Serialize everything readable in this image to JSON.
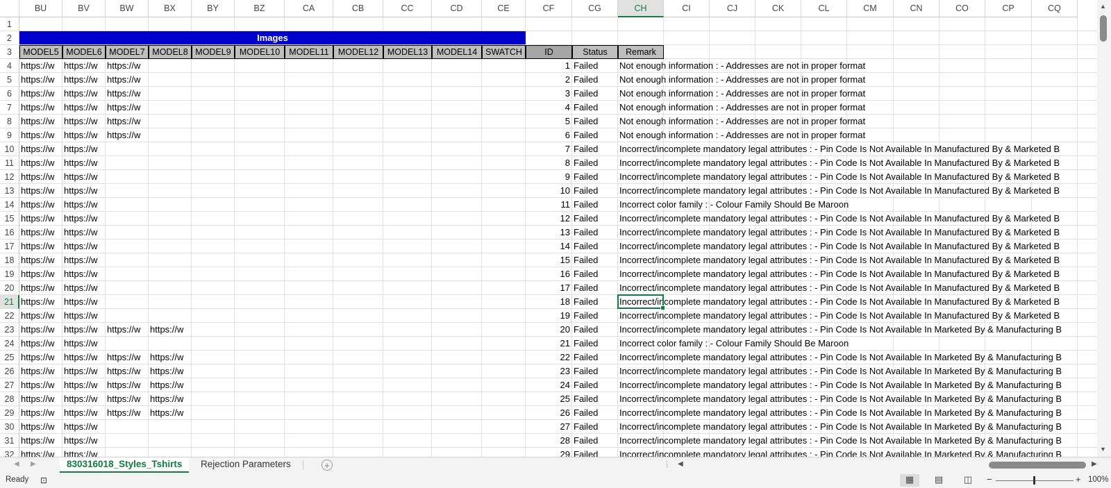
{
  "columns": [
    "BU",
    "BV",
    "BW",
    "BX",
    "BY",
    "BZ",
    "CA",
    "CB",
    "CC",
    "CD",
    "CE",
    "CF",
    "CG",
    "CH",
    "CI",
    "CJ",
    "CK",
    "CL",
    "CM",
    "CN",
    "CO",
    "CP",
    "CQ"
  ],
  "selected_column": "CH",
  "row_numbers": [
    "1",
    "2",
    "3",
    "4",
    "5",
    "6",
    "7",
    "8",
    "9",
    "10",
    "11",
    "12",
    "13",
    "14",
    "15",
    "16",
    "17",
    "18",
    "19",
    "20",
    "21",
    "22",
    "23",
    "24",
    "25",
    "26",
    "27",
    "28",
    "29",
    "30",
    "31",
    "32"
  ],
  "selected_row": "21",
  "banner_title": "Images",
  "header_row": [
    "MODEL5",
    "MODEL6",
    "MODEL7",
    "MODEL8",
    "MODEL9",
    "MODEL10",
    "MODEL11",
    "MODEL12",
    "MODEL13",
    "MODEL14",
    "SWATCH",
    "ID",
    "Status",
    "Remark"
  ],
  "url_text": "https://w",
  "rows": [
    {
      "urls": 3,
      "id": "1",
      "status": "Failed",
      "remark": "Not enough information :  - Addresses are not in proper format"
    },
    {
      "urls": 3,
      "id": "2",
      "status": "Failed",
      "remark": "Not enough information :  - Addresses are not in proper format"
    },
    {
      "urls": 3,
      "id": "3",
      "status": "Failed",
      "remark": "Not enough information :  - Addresses are not in proper format"
    },
    {
      "urls": 3,
      "id": "4",
      "status": "Failed",
      "remark": "Not enough information :  - Addresses are not in proper format"
    },
    {
      "urls": 3,
      "id": "5",
      "status": "Failed",
      "remark": "Not enough information :  - Addresses are not in proper format"
    },
    {
      "urls": 3,
      "id": "6",
      "status": "Failed",
      "remark": "Not enough information :  - Addresses are not in proper format"
    },
    {
      "urls": 2,
      "id": "7",
      "status": "Failed",
      "remark": "Incorrect/incomplete mandatory legal attributes :  - Pin Code Is Not Available In Manufactured By & Marketed B"
    },
    {
      "urls": 2,
      "id": "8",
      "status": "Failed",
      "remark": "Incorrect/incomplete mandatory legal attributes :  - Pin Code Is Not Available In Manufactured By & Marketed B"
    },
    {
      "urls": 2,
      "id": "9",
      "status": "Failed",
      "remark": "Incorrect/incomplete mandatory legal attributes :  - Pin Code Is Not Available In Manufactured By & Marketed B"
    },
    {
      "urls": 2,
      "id": "10",
      "status": "Failed",
      "remark": "Incorrect/incomplete mandatory legal attributes :  - Pin Code Is Not Available In Manufactured By & Marketed B"
    },
    {
      "urls": 2,
      "id": "11",
      "status": "Failed",
      "remark": "Incorrect color family :  - Colour Family Should Be Maroon"
    },
    {
      "urls": 2,
      "id": "12",
      "status": "Failed",
      "remark": "Incorrect/incomplete mandatory legal attributes :  - Pin Code Is Not Available In Manufactured By & Marketed B"
    },
    {
      "urls": 2,
      "id": "13",
      "status": "Failed",
      "remark": "Incorrect/incomplete mandatory legal attributes :  - Pin Code Is Not Available In Manufactured By & Marketed B"
    },
    {
      "urls": 2,
      "id": "14",
      "status": "Failed",
      "remark": "Incorrect/incomplete mandatory legal attributes :  - Pin Code Is Not Available In Manufactured By & Marketed B"
    },
    {
      "urls": 2,
      "id": "15",
      "status": "Failed",
      "remark": "Incorrect/incomplete mandatory legal attributes :  - Pin Code Is Not Available In Manufactured By & Marketed B"
    },
    {
      "urls": 2,
      "id": "16",
      "status": "Failed",
      "remark": "Incorrect/incomplete mandatory legal attributes :  - Pin Code Is Not Available In Manufactured By & Marketed B"
    },
    {
      "urls": 2,
      "id": "17",
      "status": "Failed",
      "remark": "Incorrect/incomplete mandatory legal attributes :  - Pin Code Is Not Available In Manufactured By & Marketed B"
    },
    {
      "urls": 2,
      "id": "18",
      "status": "Failed",
      "remark": "Incorrect/incomplete mandatory legal attributes :  - Pin Code Is Not Available In Manufactured By & Marketed B"
    },
    {
      "urls": 2,
      "id": "19",
      "status": "Failed",
      "remark": "Incorrect/incomplete mandatory legal attributes :  - Pin Code Is Not Available In Manufactured By & Marketed B"
    },
    {
      "urls": 4,
      "id": "20",
      "status": "Failed",
      "remark": "Incorrect/incomplete mandatory legal attributes :  - Pin Code Is Not Available In Marketed By & Manufacturing B"
    },
    {
      "urls": 2,
      "id": "21",
      "status": "Failed",
      "remark": "Incorrect color family :  - Colour Family Should Be Maroon"
    },
    {
      "urls": 4,
      "id": "22",
      "status": "Failed",
      "remark": "Incorrect/incomplete mandatory legal attributes :  - Pin Code Is Not Available In Marketed By & Manufacturing B"
    },
    {
      "urls": 4,
      "id": "23",
      "status": "Failed",
      "remark": "Incorrect/incomplete mandatory legal attributes :  - Pin Code Is Not Available In Marketed By & Manufacturing B"
    },
    {
      "urls": 4,
      "id": "24",
      "status": "Failed",
      "remark": "Incorrect/incomplete mandatory legal attributes :  - Pin Code Is Not Available In Marketed By & Manufacturing B"
    },
    {
      "urls": 4,
      "id": "25",
      "status": "Failed",
      "remark": "Incorrect/incomplete mandatory legal attributes :  - Pin Code Is Not Available In Marketed By & Manufacturing B"
    },
    {
      "urls": 4,
      "id": "26",
      "status": "Failed",
      "remark": "Incorrect/incomplete mandatory legal attributes :  - Pin Code Is Not Available In Marketed By & Manufacturing B"
    },
    {
      "urls": 2,
      "id": "27",
      "status": "Failed",
      "remark": "Incorrect/incomplete mandatory legal attributes :  - Pin Code Is Not Available In Marketed By & Manufacturing B"
    },
    {
      "urls": 2,
      "id": "28",
      "status": "Failed",
      "remark": "Incorrect/incomplete mandatory legal attributes :  - Pin Code Is Not Available In Marketed By & Manufacturing B"
    },
    {
      "urls": 2,
      "id": "29",
      "status": "Failed",
      "remark": "Incorrect/incomplete mandatory legal attributes :  - Pin Code Is Not Available In Marketed By & Manufacturing B"
    }
  ],
  "sheet_tabs": [
    {
      "label": "830316018_Styles_Tshirts",
      "active": true
    },
    {
      "label": "Rejection Parameters",
      "active": false
    }
  ],
  "status": {
    "ready": "Ready",
    "zoom": "100%"
  },
  "icons": {
    "tab_prev": "chevron-left-icon",
    "tab_next": "chevron-right-icon",
    "add_sheet": "plus-circle-icon",
    "accessibility": "accessibility-icon",
    "normal_view": "grid-icon",
    "page_layout": "page-layout-icon",
    "page_break": "page-break-icon"
  },
  "colors": {
    "banner": "#0000cc",
    "header_fill": "#bfbfbf",
    "accent": "#107c41"
  }
}
